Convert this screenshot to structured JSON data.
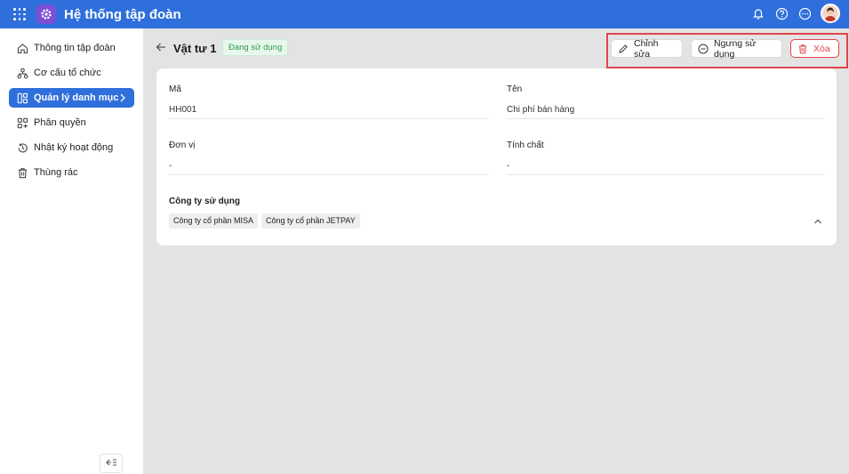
{
  "app": {
    "title": "Hệ thống tập đoàn"
  },
  "topbar": {
    "icons": [
      "apps-grid-icon",
      "bell-icon",
      "help-icon",
      "more-icon",
      "avatar"
    ]
  },
  "sidebar": {
    "items": [
      {
        "label": "Thông tin tập đoàn",
        "icon": "home-icon"
      },
      {
        "label": "Cơ cấu tổ chức",
        "icon": "org-icon"
      },
      {
        "label": "Quản lý danh mục",
        "icon": "catalog-icon",
        "active": true
      },
      {
        "label": "Phân quyền",
        "icon": "permission-icon"
      },
      {
        "label": "Nhật ký hoạt động",
        "icon": "history-icon"
      },
      {
        "label": "Thùng rác",
        "icon": "trash-icon"
      }
    ]
  },
  "header": {
    "title": "Vật tư 1",
    "status": "Đang sử dụng",
    "actions": {
      "edit": "Chỉnh sửa",
      "stop": "Ngưng sử dụng",
      "delete": "Xóa"
    }
  },
  "detail": {
    "code": {
      "label": "Mã",
      "value": "HH001"
    },
    "name": {
      "label": "Tên",
      "value": "Chi phí bán hàng"
    },
    "unit": {
      "label": "Đơn vị",
      "value": "-"
    },
    "nature": {
      "label": "Tính chất",
      "value": "-"
    },
    "companies": {
      "label": "Công ty sử dụng",
      "items": [
        "Công ty cổ phần MISA",
        "Công ty cổ phần JETPAY"
      ]
    }
  },
  "colors": {
    "primary": "#2f6fdc",
    "danger": "#e0454c",
    "success": "#2a9b48"
  }
}
